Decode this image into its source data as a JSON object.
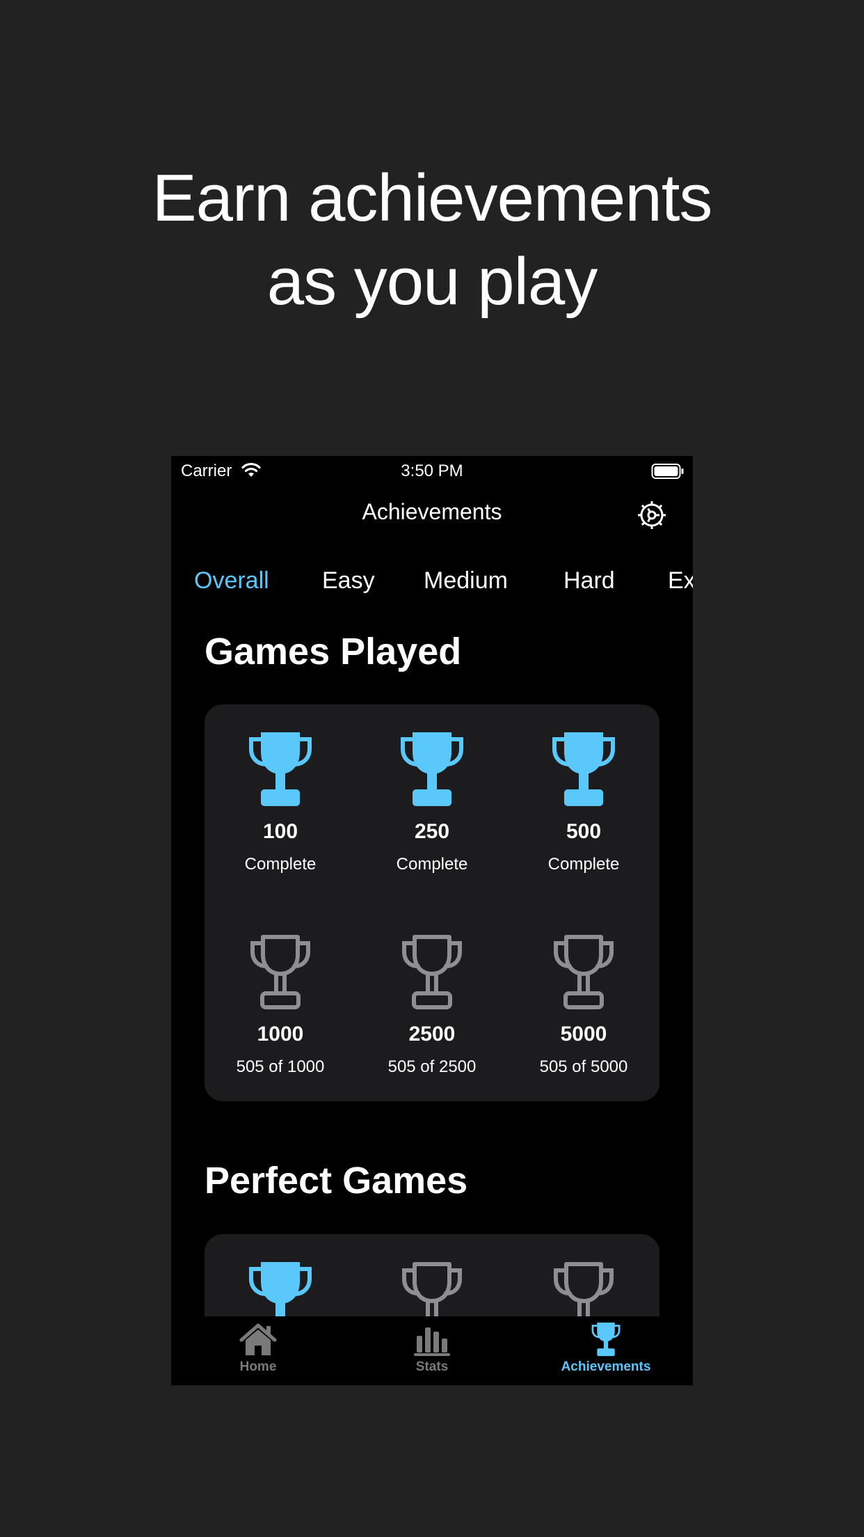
{
  "headline": {
    "line1": "Earn achievements",
    "line2": "as you play"
  },
  "status_bar": {
    "carrier": "Carrier",
    "time": "3:50 PM"
  },
  "nav": {
    "title": "Achievements",
    "settings_icon": "gear-icon"
  },
  "tabs": [
    {
      "label": "Overall",
      "active": true
    },
    {
      "label": "Easy"
    },
    {
      "label": "Medium"
    },
    {
      "label": "Hard"
    },
    {
      "label": "Ex"
    }
  ],
  "sections": [
    {
      "title": "Games Played",
      "items": [
        {
          "title": "100",
          "status": "Complete",
          "earned": true
        },
        {
          "title": "250",
          "status": "Complete",
          "earned": true
        },
        {
          "title": "500",
          "status": "Complete",
          "earned": true
        },
        {
          "title": "1000",
          "status": "505 of 1000",
          "earned": false
        },
        {
          "title": "2500",
          "status": "505 of 2500",
          "earned": false
        },
        {
          "title": "5000",
          "status": "505 of 5000",
          "earned": false
        }
      ]
    },
    {
      "title": "Perfect Games",
      "items": [
        {
          "earned": true
        },
        {
          "earned": false
        },
        {
          "earned": false
        }
      ]
    }
  ],
  "tab_bar": [
    {
      "label": "Home",
      "icon": "house-icon"
    },
    {
      "label": "Stats",
      "icon": "bar-chart-icon"
    },
    {
      "label": "Achievements",
      "icon": "trophy-icon",
      "active": true
    }
  ],
  "colors": {
    "accent": "#5AC8FA",
    "unearned": "#8E8E93",
    "card": "#1C1C1E",
    "page_bg": "#222222"
  }
}
